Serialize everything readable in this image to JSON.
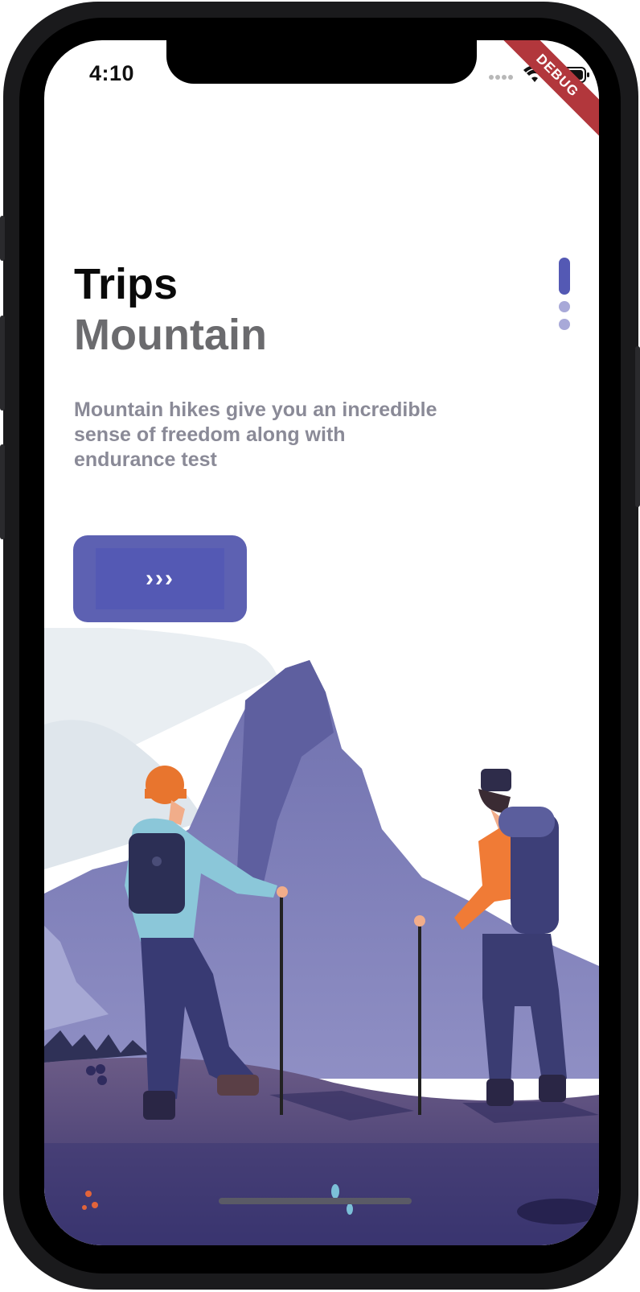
{
  "status_bar": {
    "time": "4:10",
    "debug_label": "DEBUG"
  },
  "onboarding": {
    "title": "Trips",
    "subtitle": "Mountain",
    "description": "Mountain hikes give you an incredible sense of freedom along with endurance test",
    "next_button_label": "›››",
    "page_indicator": {
      "total": 3,
      "active_index": 0
    }
  },
  "colors": {
    "accent": "#5459b4",
    "indicator_inactive": "#a8a9d8",
    "debug_banner": "#b2373c",
    "title": "#0a0a0a",
    "subtitle": "#6b6b6e",
    "description": "#8a8a97"
  },
  "icons": [
    "signal-dots-icon",
    "wifi-icon",
    "battery-icon",
    "chevrons-right-icon"
  ],
  "illustration": {
    "subject": "two hikers with backpacks and trekking poles facing purple mountains"
  }
}
